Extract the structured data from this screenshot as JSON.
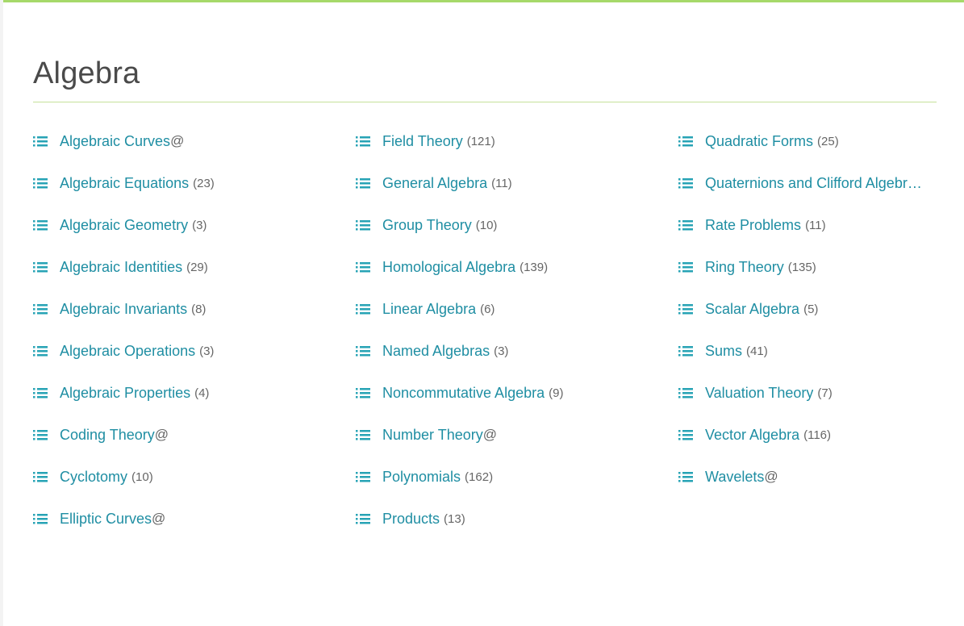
{
  "page": {
    "title": "Algebra"
  },
  "colors": {
    "accent_top": "#a6d96a",
    "rule": "#c6e29a",
    "link": "#1f8ea3",
    "icon": "#27a3b5",
    "count": "#666666"
  },
  "columns": [
    {
      "items": [
        {
          "label": "Algebraic Curves",
          "count": "",
          "suffix": "@",
          "icon": "list-icon"
        },
        {
          "label": "Algebraic Equations",
          "count": "(23)",
          "suffix": "",
          "icon": "list-icon"
        },
        {
          "label": "Algebraic Geometry",
          "count": "(3)",
          "suffix": "",
          "icon": "list-icon"
        },
        {
          "label": "Algebraic Identities",
          "count": "(29)",
          "suffix": "",
          "icon": "list-icon"
        },
        {
          "label": "Algebraic Invariants",
          "count": "(8)",
          "suffix": "",
          "icon": "list-icon"
        },
        {
          "label": "Algebraic Operations",
          "count": "(3)",
          "suffix": "",
          "icon": "list-icon"
        },
        {
          "label": "Algebraic Properties",
          "count": "(4)",
          "suffix": "",
          "icon": "list-icon"
        },
        {
          "label": "Coding Theory",
          "count": "",
          "suffix": "@",
          "icon": "list-icon"
        },
        {
          "label": "Cyclotomy",
          "count": "(10)",
          "suffix": "",
          "icon": "list-icon"
        },
        {
          "label": "Elliptic Curves",
          "count": "",
          "suffix": "@",
          "icon": "list-icon"
        }
      ]
    },
    {
      "items": [
        {
          "label": "Field Theory",
          "count": "(121)",
          "suffix": "",
          "icon": "list-icon"
        },
        {
          "label": "General Algebra",
          "count": "(11)",
          "suffix": "",
          "icon": "list-icon"
        },
        {
          "label": "Group Theory",
          "count": "(10)",
          "suffix": "",
          "icon": "list-icon"
        },
        {
          "label": "Homological Algebra",
          "count": "(139)",
          "suffix": "",
          "icon": "list-icon"
        },
        {
          "label": "Linear Algebra",
          "count": "(6)",
          "suffix": "",
          "icon": "list-icon"
        },
        {
          "label": "Named Algebras",
          "count": "(3)",
          "suffix": "",
          "icon": "list-icon"
        },
        {
          "label": "Noncommutative Algebra",
          "count": "(9)",
          "suffix": "",
          "icon": "list-icon"
        },
        {
          "label": "Number Theory",
          "count": "",
          "suffix": "@",
          "icon": "list-icon"
        },
        {
          "label": "Polynomials",
          "count": "(162)",
          "suffix": "",
          "icon": "list-icon"
        },
        {
          "label": "Products",
          "count": "(13)",
          "suffix": "",
          "icon": "list-icon"
        }
      ]
    },
    {
      "items": [
        {
          "label": "Quadratic Forms",
          "count": "(25)",
          "suffix": "",
          "icon": "list-icon"
        },
        {
          "label": "Quaternions and Clifford Algebr…",
          "count": "",
          "suffix": "",
          "icon": "list-icon"
        },
        {
          "label": "Rate Problems",
          "count": "(11)",
          "suffix": "",
          "icon": "list-icon"
        },
        {
          "label": "Ring Theory",
          "count": "(135)",
          "suffix": "",
          "icon": "list-icon"
        },
        {
          "label": "Scalar Algebra",
          "count": "(5)",
          "suffix": "",
          "icon": "list-icon"
        },
        {
          "label": "Sums",
          "count": "(41)",
          "suffix": "",
          "icon": "list-icon"
        },
        {
          "label": "Valuation Theory",
          "count": "(7)",
          "suffix": "",
          "icon": "list-icon"
        },
        {
          "label": "Vector Algebra",
          "count": "(116)",
          "suffix": "",
          "icon": "list-icon"
        },
        {
          "label": "Wavelets",
          "count": "",
          "suffix": "@",
          "icon": "list-icon"
        }
      ]
    }
  ]
}
